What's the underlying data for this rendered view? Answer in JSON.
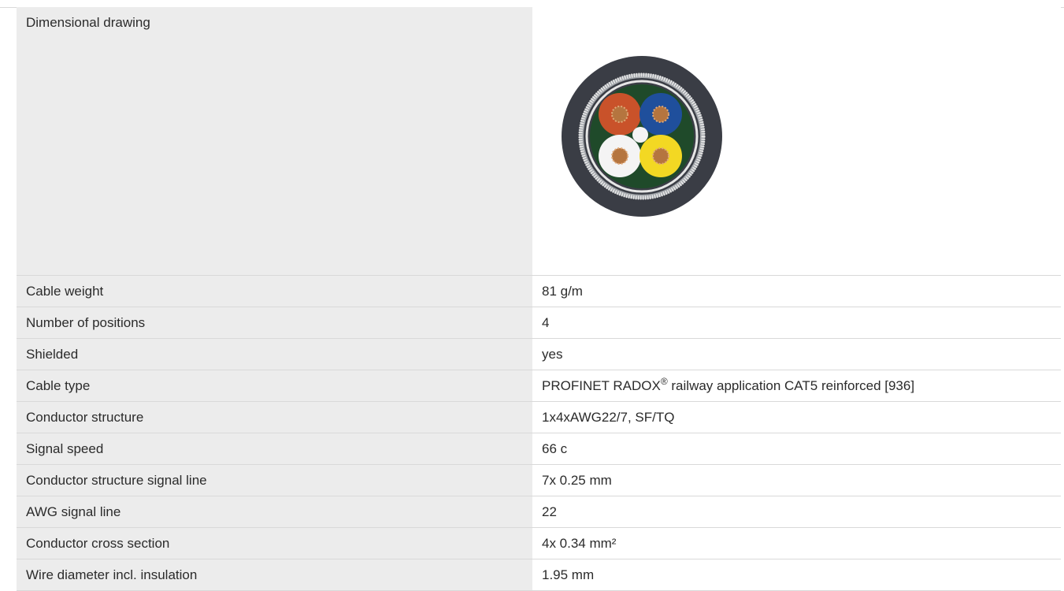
{
  "specs": {
    "drawing": {
      "label": "Dimensional drawing",
      "image": "cable cross-section"
    },
    "rows": [
      {
        "label": "Cable weight",
        "value": "81 g/m"
      },
      {
        "label": "Number of positions",
        "value": "4"
      },
      {
        "label": "Shielded",
        "value": "yes"
      },
      {
        "label": "Cable type",
        "value_before": "PROFINET RADOX",
        "value_sup": "®",
        "value_after": " railway application CAT5 reinforced [936]"
      },
      {
        "label": "Conductor structure",
        "value": "1x4xAWG22/7, SF/TQ"
      },
      {
        "label": "Signal speed",
        "value": "66 c"
      },
      {
        "label": "Conductor structure signal line",
        "value": "7x 0.25 mm"
      },
      {
        "label": "AWG signal line",
        "value": "22"
      },
      {
        "label": "Conductor cross section",
        "value": "4x 0.34 mm²"
      },
      {
        "label": "Wire diameter incl. insulation",
        "value": "1.95 mm"
      }
    ]
  },
  "colors": {
    "label_background": "#ececec",
    "divider": "#d9d9d9",
    "text": "#2b2b2b",
    "outer_jacket": "#3a3d45",
    "inner_filler": "#1f4a2a",
    "core_orange": "#c9522a",
    "core_blue": "#1f4f9c",
    "core_white": "#f4f4f4",
    "core_yellow": "#f3d823",
    "copper": "#b5753f"
  }
}
